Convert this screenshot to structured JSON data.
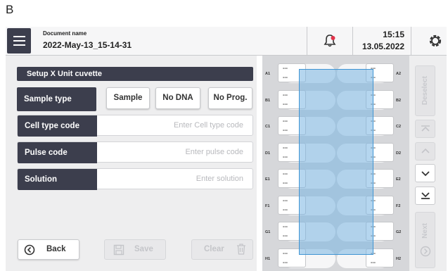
{
  "panel_letter": "B",
  "header": {
    "doc_label": "Document name",
    "doc_name": "2022-May-13_15-14-31",
    "time": "15:15",
    "date": "13.05.2022"
  },
  "form": {
    "title": "Setup X Unit cuvette",
    "sample_type": {
      "label": "Sample type",
      "options": [
        "Sample",
        "No DNA",
        "No Prog."
      ]
    },
    "cell_type": {
      "label": "Cell type code",
      "placeholder": "Enter Cell type code"
    },
    "pulse_code": {
      "label": "Pulse code",
      "placeholder": "Enter pulse code"
    },
    "solution": {
      "label": "Solution",
      "placeholder": "Enter solution"
    }
  },
  "buttons": {
    "back": "Back",
    "save": "Save",
    "clear": "Clear"
  },
  "plate": {
    "rows": [
      "A",
      "B",
      "C",
      "D",
      "E",
      "F",
      "G",
      "H"
    ],
    "left_labels": [
      "A1",
      "B1",
      "C1",
      "D1",
      "E1",
      "F1",
      "G1",
      "H1"
    ],
    "right_labels": [
      "A2",
      "B2",
      "C2",
      "D2",
      "E2",
      "F2",
      "G2",
      "H2"
    ],
    "cell_text": "---"
  },
  "nav": {
    "deselect": "Deselect",
    "next": "Next"
  },
  "colors": {
    "dark": "#3c3e4d",
    "highlight": "#78b4e1",
    "alert_dot": "#e2334b"
  }
}
